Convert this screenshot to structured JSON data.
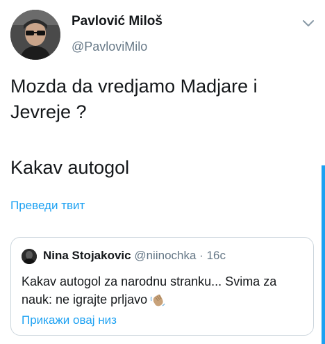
{
  "tweet": {
    "author": {
      "display_name": "Pavlović Miloš",
      "handle": "@PavloviMilo",
      "avatar_icon": "user-avatar-sunglasses"
    },
    "menu_icon": "chevron-down-icon",
    "text_lines": [
      "Mozda da vredjamo Madjare i",
      "Jevreje ?"
    ],
    "text_line_2": "Kakav autogol",
    "translate_label": "Преведи твит"
  },
  "quoted_tweet": {
    "author": {
      "display_name": "Nina Stojakovic",
      "handle": "@niinochka",
      "avatar_icon": "user-avatar-dark"
    },
    "separator": "·",
    "time": "16с",
    "text": "Kakav autogol za narodnu stranku... Svima za nauk: ne igrajte prljavo",
    "emoji": "waving-hand-emoji",
    "show_thread_label": "Прикажи овај низ"
  },
  "colors": {
    "link_blue": "#1da1f2",
    "secondary_text": "#657786",
    "border": "#ccd6dd",
    "primary_text": "#14171a"
  }
}
